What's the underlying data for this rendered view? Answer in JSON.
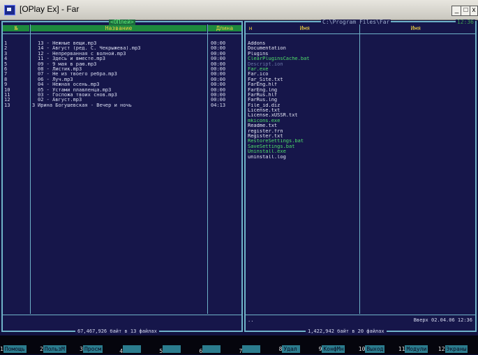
{
  "window": {
    "title": "[OPlay Ex] - Far"
  },
  "left_panel": {
    "path": "<ОПлей>",
    "headers": {
      "num": "№",
      "name": "Название",
      "duration": "Длина"
    },
    "tracks": [
      {
        "num": "1",
        "mark": "",
        "name": "13 - Нежные вещи.mp3",
        "duration": "00:00"
      },
      {
        "num": "2",
        "mark": "",
        "name": "14 - Август (ред. С. Чекрыжева).mp3",
        "duration": "00:00"
      },
      {
        "num": "3",
        "mark": "",
        "name": "12 - Непрерванная с волной.mp3",
        "duration": "00:00"
      },
      {
        "num": "4",
        "mark": "",
        "name": "11 - Здесь и вместе.mp3",
        "duration": "00:00"
      },
      {
        "num": "5",
        "mark": "",
        "name": "09 - 9 мая в раю.mp3",
        "duration": "00:00"
      },
      {
        "num": "6",
        "mark": "",
        "name": "08 - Листик.mp3",
        "duration": "00:00"
      },
      {
        "num": "7",
        "mark": "",
        "name": "07 - Не из твоего ребра.mp3",
        "duration": "00:00"
      },
      {
        "num": "8",
        "mark": "",
        "name": "06 - Луч.mp3",
        "duration": "00:00"
      },
      {
        "num": "9",
        "mark": "",
        "name": "04 - Нежная осень.mp3",
        "duration": "00:00"
      },
      {
        "num": "10",
        "mark": "",
        "name": "05 - Устами плавленца.mp3",
        "duration": "00:00"
      },
      {
        "num": "11",
        "mark": "",
        "name": "03 - Госпожа твоих снов.mp3",
        "duration": "00:00"
      },
      {
        "num": "12",
        "mark": "",
        "name": "02 - Август.mp3",
        "duration": "00:00"
      },
      {
        "num": "13",
        "mark": "3",
        "name": "Ирина Богушевская - Вечер и ночь",
        "duration": "04:13"
      }
    ],
    "footer": "67,467,926 байт в 13 файлах"
  },
  "right_panel": {
    "path": "C:\\Program Files\\Far",
    "clock": "12:36",
    "headers": {
      "marker": "н",
      "name1": "Имя",
      "name2": "Имя"
    },
    "files": [
      {
        "name": "Addons",
        "color": "white"
      },
      {
        "name": "Documentation",
        "color": "white"
      },
      {
        "name": "Plugins",
        "color": "white"
      },
      {
        "name": "ClearPluginsCache.bat",
        "color": "green"
      },
      {
        "name": "Descript.ion",
        "color": "dim"
      },
      {
        "name": "Far.exe",
        "color": "green"
      },
      {
        "name": "Far.ico",
        "color": "white"
      },
      {
        "name": "Far_Site.txt",
        "color": "white"
      },
      {
        "name": "FarEng.hlf",
        "color": "white"
      },
      {
        "name": "FarEng.lng",
        "color": "white"
      },
      {
        "name": "FarRus.hlf",
        "color": "white"
      },
      {
        "name": "FarRus.lng",
        "color": "white"
      },
      {
        "name": "File_id.diz",
        "color": "white"
      },
      {
        "name": "License.txt",
        "color": "white"
      },
      {
        "name": "License.xUSSR.txt",
        "color": "white"
      },
      {
        "name": "mkicons.exe",
        "color": "green"
      },
      {
        "name": "Readme.txt",
        "color": "white"
      },
      {
        "name": "register.frn",
        "color": "white"
      },
      {
        "name": "Register.txt",
        "color": "white"
      },
      {
        "name": "RestoreSettings.bat",
        "color": "green"
      },
      {
        "name": "SaveSettings.bat",
        "color": "green"
      },
      {
        "name": "Uninstall.exe",
        "color": "green"
      },
      {
        "name": "uninstall.log",
        "color": "white"
      }
    ],
    "status_left": "..",
    "status_right": "Вверх 02.04.06 12:36",
    "footer": "1,422,942 байт в 20 файлах"
  },
  "keybar": [
    {
      "num": "1",
      "label": "Помощь"
    },
    {
      "num": "2",
      "label": "ПользМ"
    },
    {
      "num": "3",
      "label": "Просм"
    },
    {
      "num": "4",
      "label": ""
    },
    {
      "num": "5",
      "label": ""
    },
    {
      "num": "6",
      "label": ""
    },
    {
      "num": "7",
      "label": ""
    },
    {
      "num": "8",
      "label": "Удал"
    },
    {
      "num": "9",
      "label": "КонфМн"
    },
    {
      "num": "10",
      "label": "Выход"
    },
    {
      "num": "11",
      "label": "Модули"
    },
    {
      "num": "12",
      "label": "Экраны"
    }
  ]
}
